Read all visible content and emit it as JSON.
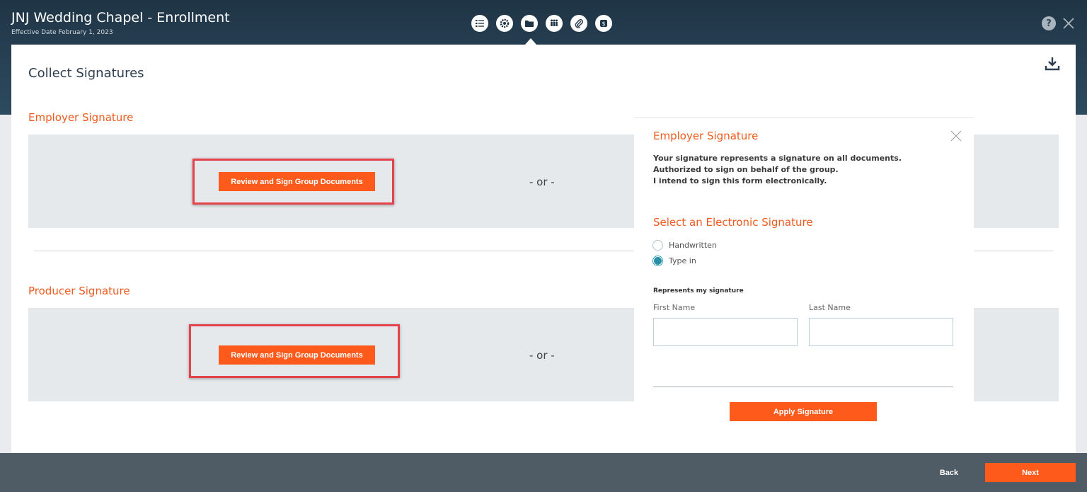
{
  "header": {
    "title": "JNJ Wedding Chapel - Enrollment",
    "subtitle": "Effective Date February 1, 2023",
    "steps": [
      {
        "icon": "checklist-icon"
      },
      {
        "icon": "gear-icon"
      },
      {
        "icon": "folder-icon",
        "active": true
      },
      {
        "icon": "people-icon"
      },
      {
        "icon": "paperclip-icon"
      },
      {
        "icon": "money-icon"
      }
    ],
    "help_label": "?"
  },
  "main": {
    "page_title": "Collect Signatures",
    "employer": {
      "section_title": "Employer Signature",
      "review_button": "Review and Sign Group Documents",
      "or_text": "- or -"
    },
    "producer": {
      "section_title": "Producer Signature",
      "review_button": "Review and Sign Group Documents",
      "or_text": "- or -"
    }
  },
  "panel": {
    "title": "Employer Signature",
    "disclaimer": [
      "Your signature represents a signature on all documents.",
      "Authorized to sign on behalf of the group.",
      "I intend to sign this form electronically."
    ],
    "select_title": "Select an Electronic Signature",
    "options": [
      {
        "label": "Handwritten",
        "checked": false
      },
      {
        "label": "Type in",
        "checked": true
      }
    ],
    "represents_label": "Represents my signature",
    "first_name_label": "First Name",
    "last_name_label": "Last Name",
    "first_name_value": "",
    "last_name_value": "",
    "apply_button": "Apply Signature"
  },
  "footer": {
    "back_label": "Back",
    "next_label": "Next"
  },
  "colors": {
    "accent": "#fe5a1b",
    "header": "#233a4c",
    "footer": "#4f5c66",
    "highlight": "#e5434b"
  }
}
